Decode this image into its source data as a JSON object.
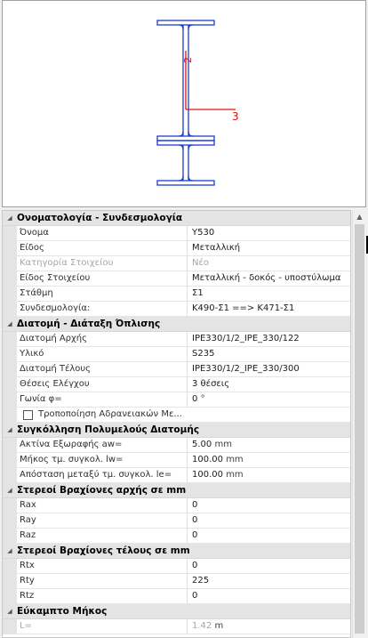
{
  "preview": {
    "axis_labels": {
      "y": "2",
      "z": "3"
    },
    "colors": {
      "section": "#1e3ccc",
      "axis": "#e01010"
    }
  },
  "grid": {
    "sections": [
      {
        "title": "Ονοματολογία - Συνδεσμολογία",
        "rows": [
          {
            "label": "Όνομα",
            "value": "Y530"
          },
          {
            "label": "Είδος",
            "value": "Μεταλλική"
          },
          {
            "label": "Κατηγορία Στοιχείου",
            "value": "Νέο",
            "disabled": true
          },
          {
            "label": "Είδος Στοιχείου",
            "value": "Μεταλλική - δοκός - υποστύλωμα"
          },
          {
            "label": "Στάθμη",
            "value": "Σ1"
          },
          {
            "label": "Συνδεσμολογία:",
            "value": "K490-Σ1 ==> K471-Σ1"
          }
        ]
      },
      {
        "title": "Διατομή - Διάταξη Όπλισης",
        "rows": [
          {
            "label": "Διατομή Αρχής",
            "value": "IPE330/1/2_IPE_330/122"
          },
          {
            "label": "Υλικό",
            "value": "S235"
          },
          {
            "label": "Διατομή Τέλους",
            "value": "IPE330/1/2_IPE_330/300"
          },
          {
            "label": "Θέσεις Ελέγχου",
            "value": "3 θέσεις"
          },
          {
            "label": "Γωνία φ=",
            "value": "0",
            "unit": "°"
          },
          {
            "label": "Τροποποίηση Αδρανειακών Με...",
            "checkbox": true
          }
        ]
      },
      {
        "title": "Συγκόλληση Πολυμελούς Διατομής",
        "rows": [
          {
            "label": "Ακτίνα Εξωραφής aw=",
            "value": "5.00",
            "unit": "mm"
          },
          {
            "label": "Μήκος τμ. συγκολ. lw=",
            "value": "100.00",
            "unit": "mm"
          },
          {
            "label": "Απόσταση μεταξύ τμ. συγκολ. le=",
            "value": "100.00",
            "unit": "mm"
          }
        ]
      },
      {
        "title": "Στερεοί Βραχίονες αρχής σε mm",
        "rows": [
          {
            "label": "Rax",
            "value": "0"
          },
          {
            "label": "Ray",
            "value": "0"
          },
          {
            "label": "Raz",
            "value": "0"
          }
        ]
      },
      {
        "title": "Στερεοί Βραχίονες τέλους σε mm",
        "rows": [
          {
            "label": "Rtx",
            "value": "0"
          },
          {
            "label": "Rty",
            "value": "225"
          },
          {
            "label": "Rtz",
            "value": "0"
          }
        ]
      },
      {
        "title": "Εύκαμπτο Μήκος",
        "rows": [
          {
            "label": "L=",
            "value": "1.42",
            "unit": "m",
            "disabled": true
          }
        ]
      }
    ]
  }
}
